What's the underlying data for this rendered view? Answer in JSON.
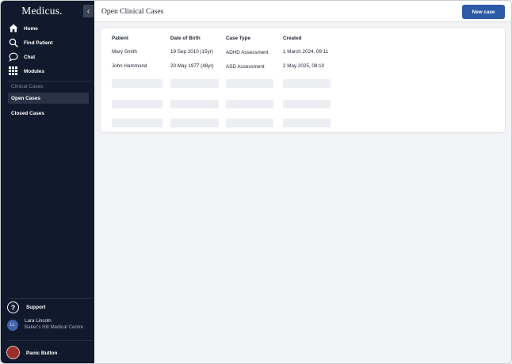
{
  "brand": "Medicus.",
  "collapse_icon": "‹",
  "nav": [
    {
      "label": "Home",
      "icon": "home-icon"
    },
    {
      "label": "Find Patient",
      "icon": "search-icon"
    },
    {
      "label": "Chat",
      "icon": "chat-icon"
    },
    {
      "label": "Modules",
      "icon": "grid-icon"
    }
  ],
  "section_label": "Clinical Cases",
  "sub_nav": [
    {
      "label": "Open Cases",
      "active": true
    },
    {
      "label": "Closed Cases",
      "active": false
    }
  ],
  "support": {
    "label": "Support",
    "icon_glyph": "?"
  },
  "user": {
    "initials": "LL",
    "name": "Lara Lincoln",
    "org": "Baker's Hill Medical Centre"
  },
  "panic": {
    "label": "Panic Button"
  },
  "header": {
    "title": "Open Clinical Cases",
    "new_case_label": "New case"
  },
  "table": {
    "columns": [
      "Patient",
      "Date of Birth",
      "Case Type",
      "Created"
    ],
    "rows": [
      [
        "Mary Smith",
        "19 Sep 2010 (15yr)",
        "ADHD Assessment",
        "1 March 2024, 09:11"
      ],
      [
        "John Hammond",
        "20 May 1977 (48yr)",
        "ASD Assessment",
        "2 May 2025, 08:10"
      ]
    ],
    "placeholder_rows": 3
  },
  "colors": {
    "sidebar": "#111a2c",
    "accent": "#2c5aa7",
    "panic": "#9c2d2d",
    "background": "#f2f3f5"
  }
}
